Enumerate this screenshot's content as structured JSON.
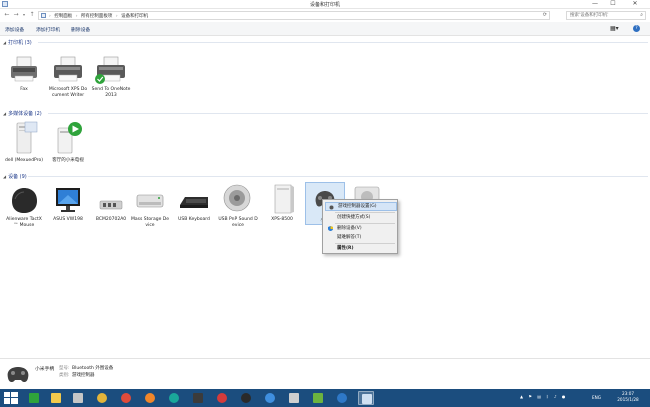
{
  "window": {
    "title": "设备和打印机",
    "min": "—",
    "max": "☐",
    "close": "✕"
  },
  "address": {
    "crumbs": [
      "控制面板",
      "所有控制面板项",
      "设备和打印机"
    ],
    "search_placeholder": "搜索'设备和打印机'"
  },
  "commands": {
    "add_device": "添加设备",
    "add_printer": "添加打印机",
    "remove_device": "删除设备",
    "help": "?"
  },
  "groups": {
    "printers": {
      "title": "打印机 (3)",
      "items": [
        {
          "label": "Fax"
        },
        {
          "label": "Microsoft XPS Document Writer"
        },
        {
          "label": "Send To OneNote 2013"
        }
      ]
    },
    "multimedia": {
      "title": "多媒体设备 (2)",
      "items": [
        {
          "label": "dell (MexuedPro)"
        },
        {
          "label": "客厅的小米电视"
        }
      ]
    },
    "devices": {
      "title": "设备 (9)",
      "items": [
        {
          "label": "Alienware TactX™ Mouse"
        },
        {
          "label": "ASUS VW198"
        },
        {
          "label": "BCM20702A0"
        },
        {
          "label": "Mass Storage Device"
        },
        {
          "label": "USB Keyboard"
        },
        {
          "label": "USB PnP Sound Device"
        },
        {
          "label": "XPS-8500"
        },
        {
          "label": "小米"
        }
      ]
    }
  },
  "context_menu": {
    "items": [
      {
        "label": "游戏控制器设置(G)"
      },
      {
        "label": "创建快捷方式(S)"
      },
      {
        "label": "删除设备(V)"
      },
      {
        "label": "疑难解答(T)"
      },
      {
        "label": "属性(R)"
      }
    ]
  },
  "details": {
    "name": "小米手柄",
    "model_key": "型号:",
    "model_value": "Bluetooth 外围设备",
    "category_key": "类别:",
    "category_value": "游戏控制器"
  },
  "taskbar": {
    "lang": "ENG",
    "time": "23:07",
    "date": "2015/1/28"
  }
}
